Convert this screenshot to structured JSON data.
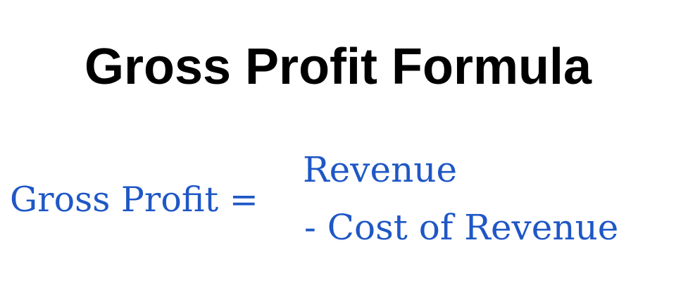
{
  "title": "Gross Profit Formula",
  "formula": {
    "lhs": "Gross Profit =",
    "line1": "Revenue",
    "line2": "- Cost of Revenue"
  },
  "colors": {
    "title": "#000000",
    "formula": "#1f57c6",
    "background": "#ffffff"
  }
}
